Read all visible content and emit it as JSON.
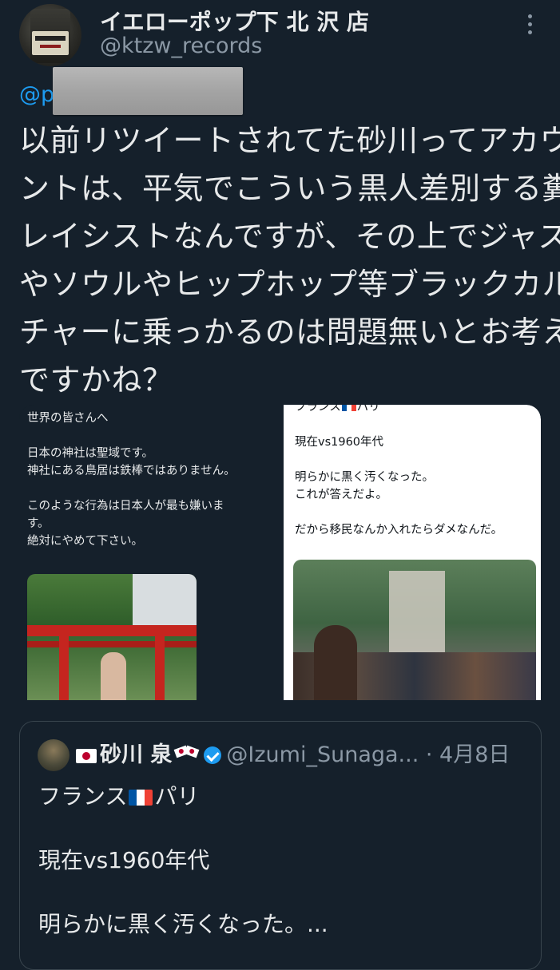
{
  "author": {
    "display_name": "イエローポップ下 北 沢 店",
    "handle": "@ktzw_records"
  },
  "reply_mention": "@p                        o",
  "tweet": {
    "lines": [
      "以前リツイートされてた砂川ってアカウ",
      "ントは、平気でこういう黒人差別する糞",
      "レイシストなんですが、その上でジャズ",
      "やソウルやヒップホップ等ブラックカル",
      "チャーに乗っかるのは問題無いとお考え",
      "ですかね？"
    ]
  },
  "media": {
    "left": {
      "lines": [
        "世界の皆さんへ",
        "日本の神社は聖域です。",
        "神社にある鳥居は鉄棒ではありません。",
        "このような行為は日本人が最も嫌いま",
        "す。",
        "絶対にやめて下さい。"
      ]
    },
    "right": {
      "top_prefix": "フランス",
      "top_suffix": "パリ",
      "lines": [
        "現在vs1960年代",
        "明らかに黒く汚くなった。",
        "これが答えだよ。",
        "だから移民なんか入れたらダメなんだ。"
      ]
    }
  },
  "quote": {
    "name": "砂川 泉",
    "handle": "@Izumi_Sunaga...",
    "date": "· 4月8日",
    "text_prefix": "フランス",
    "text_suffix": "パリ",
    "line2": "現在vs1960年代",
    "line3": "明らかに黒く汚くなった。..."
  },
  "icons": {
    "more": "more-vertical-icon",
    "verified": "verified-badge-icon",
    "flag_jp": "japan-flag-icon",
    "flag_fr": "france-flag-icon",
    "crossed_flags": "crossed-flags-icon"
  },
  "colors": {
    "background": "#15202b",
    "text": "#e7e9ea",
    "muted": "#8b98a5",
    "link": "#1d9bf0",
    "border": "#38444d"
  }
}
